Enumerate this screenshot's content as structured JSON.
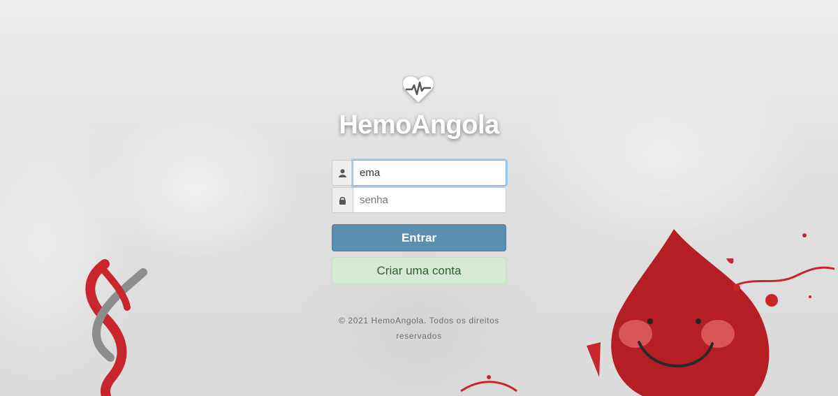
{
  "brand": {
    "name": "HemoAngola",
    "logo_icon": "heart-pulse-icon"
  },
  "login": {
    "username_value": "ema",
    "username_icon": "user-icon",
    "password_placeholder": "senha",
    "password_icon": "lock-icon",
    "submit_label": "Entrar",
    "register_label": "Criar uma conta"
  },
  "footer": {
    "copyright": "© 2021 HemoAngola. Todos os direitos reservados"
  },
  "colors": {
    "primary": "#5b8fb0",
    "success_bg": "#d7ead5",
    "success_text": "#2f5e2c",
    "blood_red": "#b51e24"
  }
}
